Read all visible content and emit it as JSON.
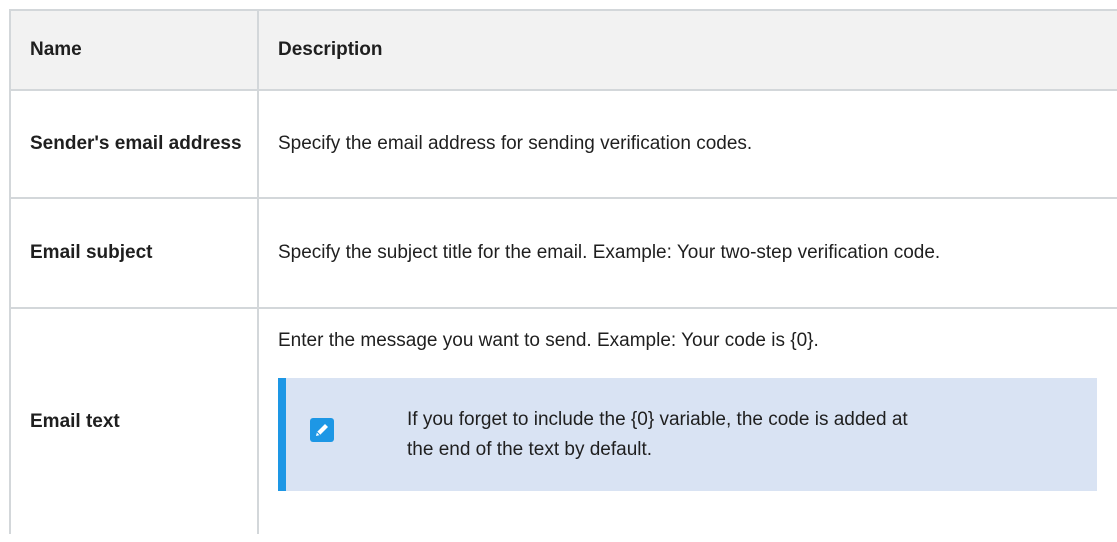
{
  "table": {
    "headers": {
      "name": "Name",
      "description": "Description"
    },
    "rows": [
      {
        "name": "Sender's email address",
        "description": "Specify the email address for sending verification codes."
      },
      {
        "name": "Email subject",
        "description": "Specify the subject title for the email. Example: Your two-step verification code."
      },
      {
        "name": "Email text",
        "description": "Enter the message you want to send. Example: Your code is {0}.",
        "note": {
          "icon": "pencil-edit-icon",
          "text": "If you forget to include the {0} variable, the code is added at the end of the text by default."
        }
      }
    ]
  },
  "colors": {
    "header_bg": "#f2f2f2",
    "border": "#d3d7da",
    "note_bg": "#d9e3f3",
    "note_accent": "#1d97e5"
  }
}
